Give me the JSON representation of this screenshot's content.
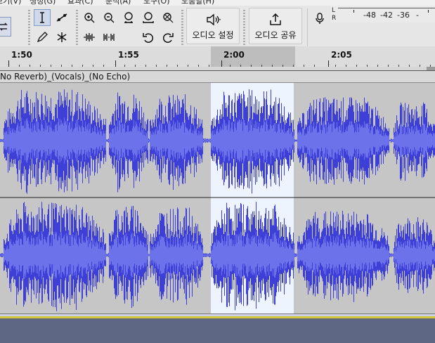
{
  "menu": {
    "items": [
      "보기(V)",
      "생성(G)",
      "효과(C)",
      "분석(A)",
      "도구(O)",
      "도움말(H)"
    ]
  },
  "toolbar": {
    "audio_setup_label": "오디오 설정",
    "share_audio_label": "오디오 공유"
  },
  "meter": {
    "channel_left": "L",
    "channel_right": "R",
    "ticks": [
      "-48",
      "-42",
      "-36",
      "-"
    ]
  },
  "timeline": {
    "labels": [
      "1:50",
      "1:55",
      "2:00",
      "2:05"
    ]
  },
  "track": {
    "title": "No Reverb)_(Vocals)_(No Echo)"
  },
  "colors": {
    "waveform": "#3d3fd6",
    "waveform_rms": "#6b72ea",
    "track_bg": "#c6c6c6",
    "selection_bg": "#eef4fe",
    "window_bg": "#5e6784"
  }
}
